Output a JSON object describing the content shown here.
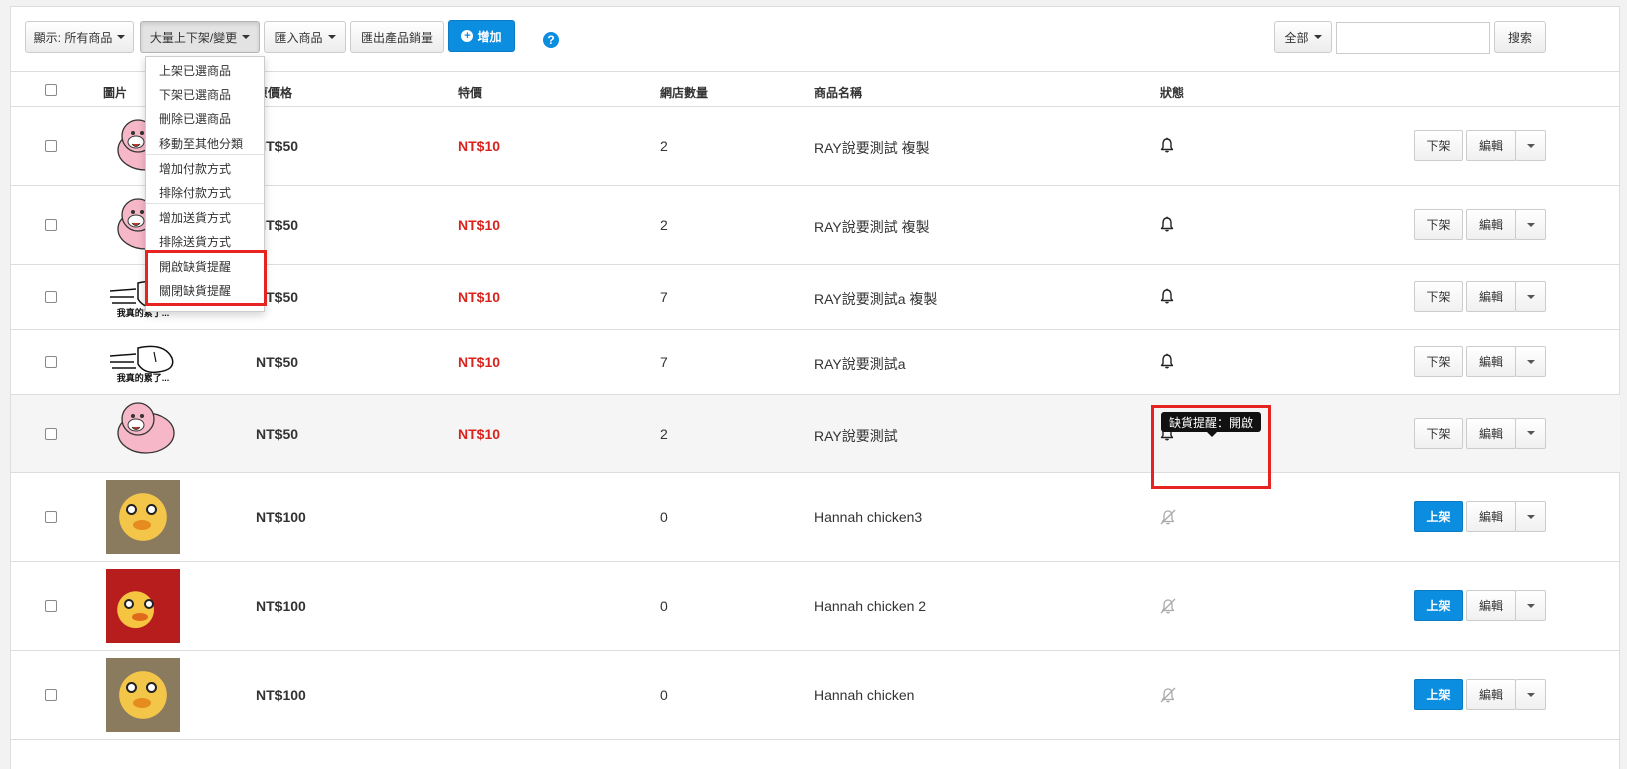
{
  "toolbar": {
    "filter_label": "顯示: 所有商品",
    "bulk_label": "大量上下架/變更",
    "import_label": "匯入商品",
    "export_label": "匯出產品銷量",
    "add_label": "增加",
    "help_glyph": "?",
    "scope_label": "全部",
    "search_placeholder": "",
    "search_label": "搜索"
  },
  "bulk_menu": {
    "items": [
      "上架已選商品",
      "下架已選商品",
      "刪除已選商品",
      "移動至其他分類",
      "增加付款方式",
      "排除付款方式",
      "增加送貨方式",
      "排除送貨方式",
      "開啟缺貨提醒",
      "關閉缺貨提醒"
    ]
  },
  "columns": [
    "圖片",
    "原價格",
    "特價",
    "網店數量",
    "商品名稱",
    "狀態"
  ],
  "rows": [
    {
      "image": "pig-icon",
      "price": "NT$50",
      "special": "NT$10",
      "qty": "2",
      "name": "RAY說要測試 複製",
      "alert": "bell-on",
      "action": "下架"
    },
    {
      "image": "pig-icon",
      "price": "NT$50",
      "special": "NT$10",
      "qty": "2",
      "name": "RAY說要測試 複製",
      "alert": "bell-on",
      "action": "下架"
    },
    {
      "image": "tired-meme",
      "price": "NT$50",
      "special": "NT$10",
      "qty": "7",
      "name": "RAY說要測試a 複製",
      "alert": "bell-on",
      "action": "下架"
    },
    {
      "image": "tired-meme",
      "price": "NT$50",
      "special": "NT$10",
      "qty": "7",
      "name": "RAY說要測試a",
      "alert": "bell-on",
      "action": "下架"
    },
    {
      "image": "pig-icon",
      "price": "NT$50",
      "special": "NT$10",
      "qty": "2",
      "name": "RAY說要測試",
      "alert": "bell-on",
      "action": "下架"
    },
    {
      "image": "chick-photo",
      "price": "NT$100",
      "special": "",
      "qty": "0",
      "name": "Hannah chicken3",
      "alert": "bell-off",
      "action": "上架"
    },
    {
      "image": "chick-red-photo",
      "price": "NT$100",
      "special": "",
      "qty": "0",
      "name": "Hannah chicken 2",
      "alert": "bell-off",
      "action": "上架"
    },
    {
      "image": "chick-photo",
      "price": "NT$100",
      "special": "",
      "qty": "0",
      "name": "Hannah chicken",
      "alert": "bell-off",
      "action": "上架"
    }
  ],
  "meme_text": "我真的累了...",
  "edit_label": "編輯",
  "tooltip": "缺貨提醒：開啟",
  "colors": {
    "accent": "#0b8de0",
    "special_price": "#d9231d",
    "highlight_box": "#e52421"
  }
}
